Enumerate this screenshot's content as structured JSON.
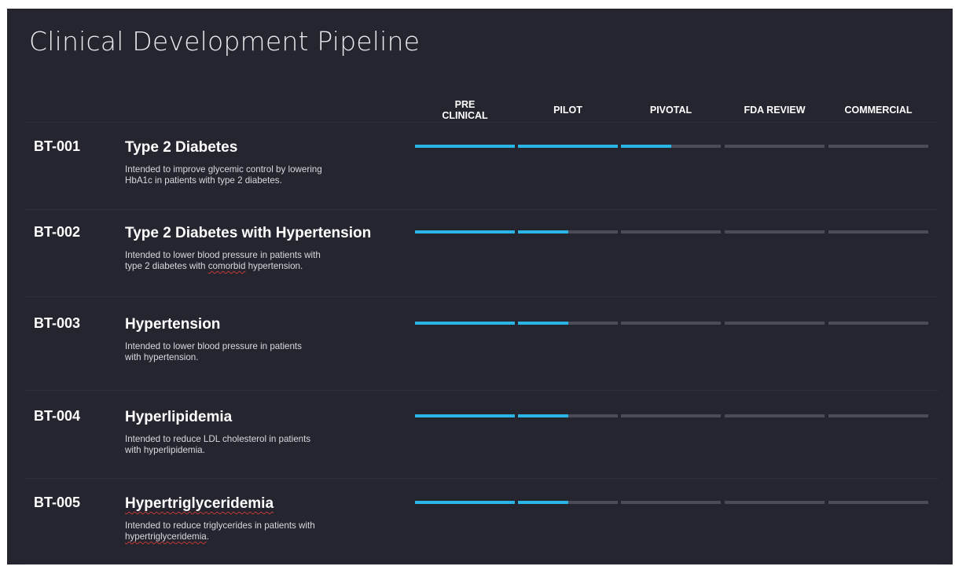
{
  "title": "Clinical Development Pipeline",
  "stages": [
    "PRE\nCLINICAL",
    "PILOT",
    "PIVOTAL",
    "FDA REVIEW",
    "COMMERCIAL"
  ],
  "colors": {
    "background": "#24252e",
    "progress": "#29b6e6",
    "track": "#4b4c57"
  },
  "programs": [
    {
      "code": "BT-001",
      "name": "Type 2 Diabetes",
      "description_lines": [
        "Intended to improve glycemic control by lowering",
        "HbA1c in patients with type 2 diabetes."
      ],
      "stage_progress": [
        1,
        1,
        0.5,
        0,
        0
      ]
    },
    {
      "code": "BT-002",
      "name": "Type 2 Diabetes with Hypertension",
      "description_lines": [
        "Intended to lower blood pressure in patients with",
        "type 2 diabetes with comorbid hypertension."
      ],
      "spellcheck_word": "comorbid",
      "stage_progress": [
        1,
        0.5,
        0,
        0,
        0
      ]
    },
    {
      "code": "BT-003",
      "name": "Hypertension",
      "description_lines": [
        "Intended to lower blood pressure in patients",
        "with hypertension."
      ],
      "stage_progress": [
        1,
        0.5,
        0,
        0,
        0
      ]
    },
    {
      "code": "BT-004",
      "name": "Hyperlipidemia",
      "description_lines": [
        "Intended to reduce LDL cholesterol in patients",
        "with hyperlipidemia."
      ],
      "stage_progress": [
        1,
        0.5,
        0,
        0,
        0
      ]
    },
    {
      "code": "BT-005",
      "name": "Hypertriglyceridemia",
      "name_spellcheck": true,
      "description_lines": [
        "Intended to reduce triglycerides in patients with",
        "hypertriglyceridemia."
      ],
      "spellcheck_word": "hypertriglyceridemia",
      "stage_progress": [
        1,
        0.5,
        0,
        0,
        0
      ]
    }
  ]
}
